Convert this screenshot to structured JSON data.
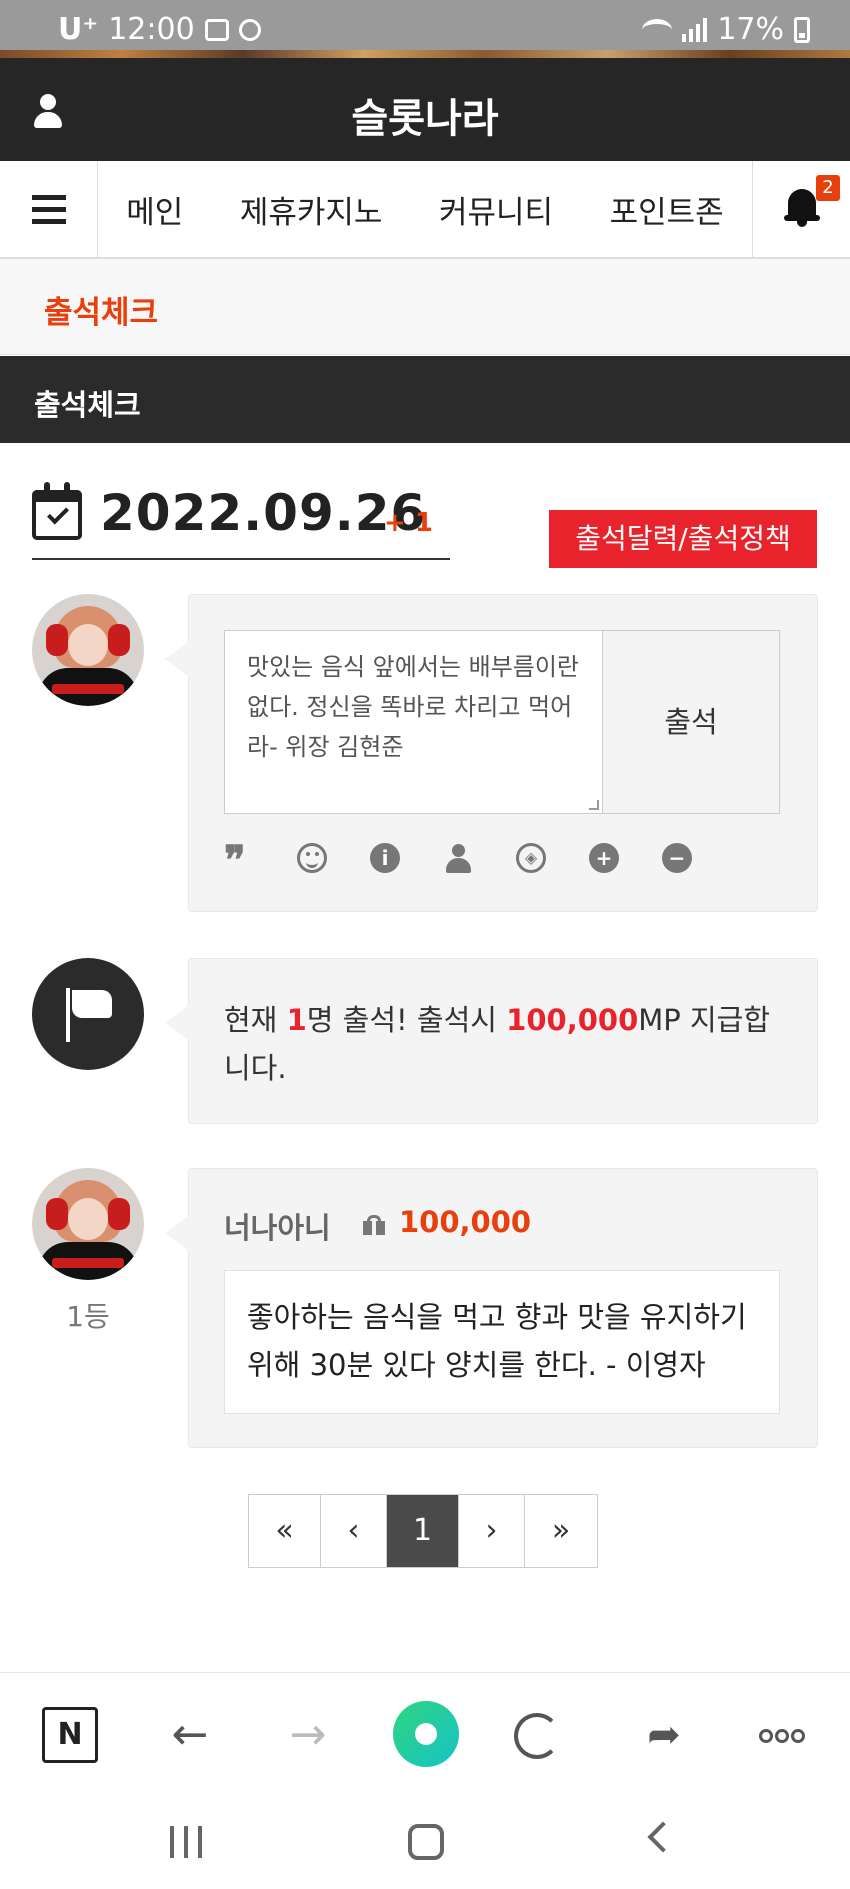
{
  "status_bar": {
    "carrier": "U⁺",
    "time": "12:00",
    "battery": "17%"
  },
  "header": {
    "title": "슬롯나라"
  },
  "nav": {
    "items": [
      "메인",
      "제휴카지노",
      "커뮤니티",
      "포인트존"
    ],
    "notification_count": "2"
  },
  "breadcrumb": {
    "label": "출석체크"
  },
  "section": {
    "title": "출석체크"
  },
  "date": {
    "value": "2022.09.26",
    "delta": "+ 1",
    "policy_button": "출석달력/출석정책"
  },
  "compose": {
    "text": "맛있는 음식 앞에서는 배부름이란 없다. 정신을 똑바로 차리고 먹어라- 위장 김현준",
    "submit_label": "출석",
    "tools": [
      "quote-icon",
      "smile-icon",
      "info-icon",
      "user-icon",
      "compass-icon",
      "plus-icon",
      "minus-icon"
    ]
  },
  "notice": {
    "prefix": "현재 ",
    "count": "1",
    "middle": "명 출석! 출석시 ",
    "points": "100,000",
    "suffix": "MP 지급합니다."
  },
  "entry": {
    "rank": "1등",
    "name": "너나아니",
    "points": "100,000",
    "message": "좋아하는 음식을 먹고 향과 맛을 유지하기 위해 30분 있다 양치를 한다. - 이영자"
  },
  "pagination": {
    "first": "«",
    "prev": "‹",
    "current": "1",
    "next": "›",
    "last": "»"
  },
  "browser_bar": {
    "n_label": "N"
  },
  "colors": {
    "accent_orange": "#e8400c",
    "accent_red": "#e8232b",
    "dark": "#262626"
  }
}
